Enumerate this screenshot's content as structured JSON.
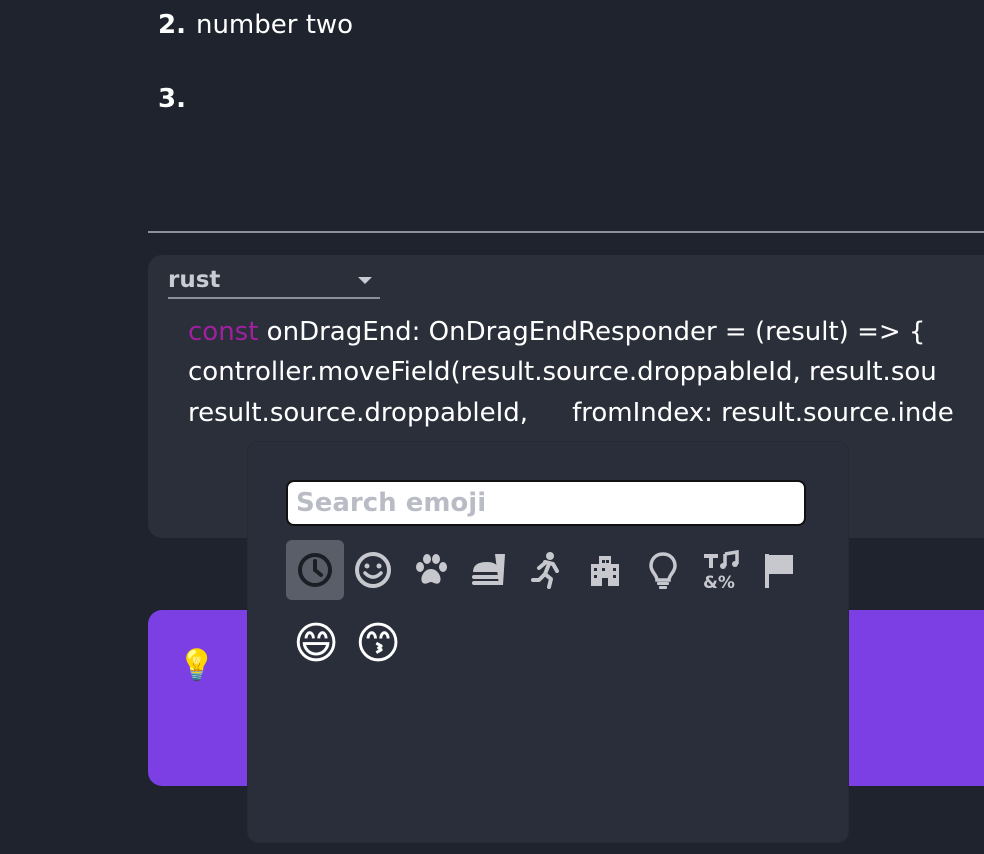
{
  "list": {
    "item2": {
      "number": "2.",
      "text": "number two"
    },
    "item3": {
      "number": "3.",
      "text": ""
    }
  },
  "code_block": {
    "language": "rust",
    "lines": {
      "l1_keyword": "const",
      "l1_rest": " onDragEnd: OnDragEndResponder = (result) => {",
      "l2": "controller.moveField(result.source.droppableId, result.sou",
      "l3_a": "result.source.droppableId,",
      "l3_b": "fromIndex: result.source.inde"
    },
    "keyword_color": "#a020a0"
  },
  "callout": {
    "icon": "💡",
    "background": "#7b3fe4"
  },
  "emoji_picker": {
    "search_placeholder": "Search emoji",
    "categories": [
      {
        "name": "recent-icon",
        "active": true
      },
      {
        "name": "smiley-icon"
      },
      {
        "name": "paw-icon"
      },
      {
        "name": "food-icon"
      },
      {
        "name": "activity-icon"
      },
      {
        "name": "building-icon"
      },
      {
        "name": "lightbulb-icon"
      },
      {
        "name": "symbols-icon"
      },
      {
        "name": "flag-icon"
      }
    ],
    "results": [
      "😄",
      "😙"
    ]
  }
}
